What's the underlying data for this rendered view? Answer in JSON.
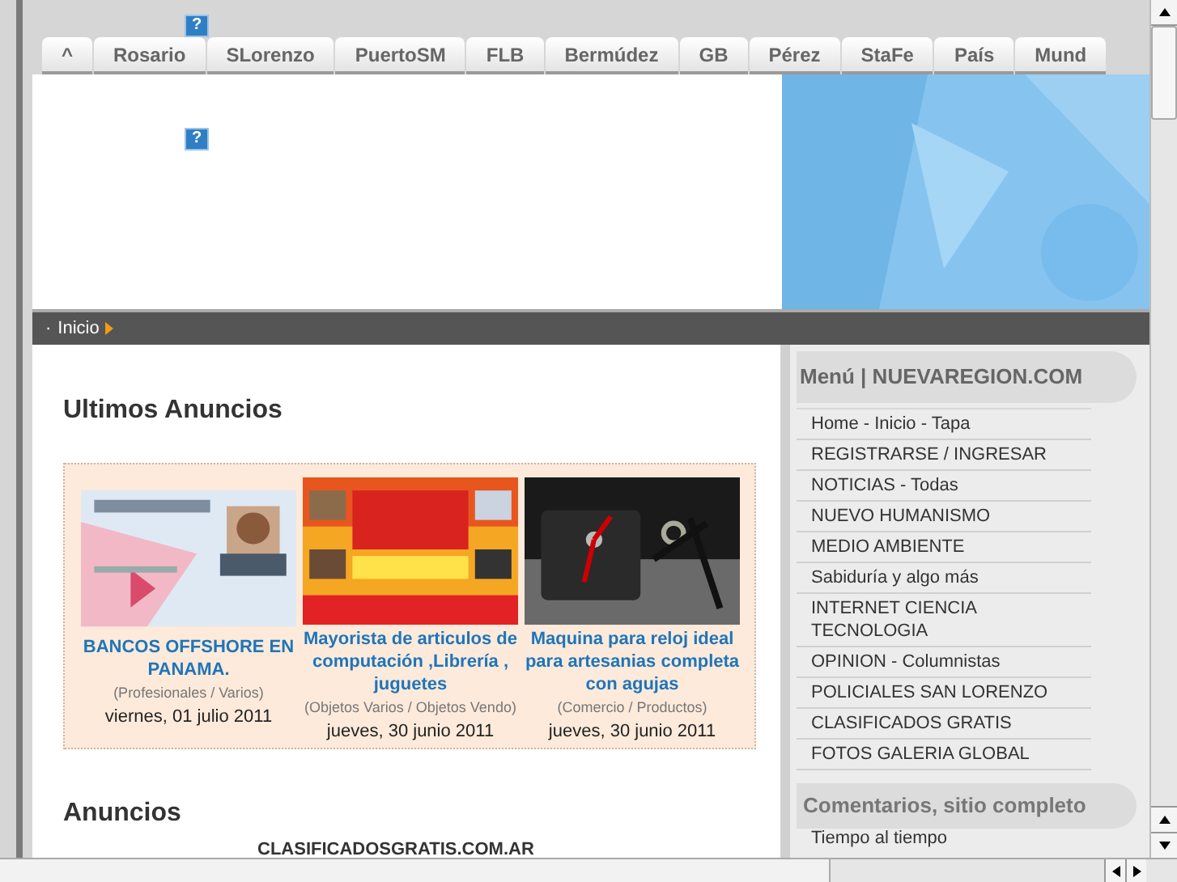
{
  "tabs": [
    {
      "label": "^"
    },
    {
      "label": "Rosario"
    },
    {
      "label": "SLorenzo"
    },
    {
      "label": "PuertoSM"
    },
    {
      "label": "FLB"
    },
    {
      "label": "Bermúdez"
    },
    {
      "label": "GB"
    },
    {
      "label": "Pérez"
    },
    {
      "label": "StaFe"
    },
    {
      "label": "País"
    },
    {
      "label": "Mund"
    }
  ],
  "help_icons": [
    "?",
    "?"
  ],
  "breadcrumb": {
    "bullet": "·",
    "label": "Inicio"
  },
  "latest_ads": {
    "title": "Ultimos Anuncios",
    "ads": [
      {
        "kind": "picture",
        "title": "BANCOS OFFSHORE EN PANAMA.",
        "category": "(Profesionales / Varios)",
        "date": "viernes, 01 julio 2011"
      },
      {
        "kind": "picture",
        "title": "Mayorista de articulos de computación ,Librería , juguetes",
        "category": "(Objetos Varios / Objetos Vendo)",
        "date": "jueves, 30 junio 2011"
      },
      {
        "kind": "picture",
        "title": "Maquina para reloj ideal para artesanias completa con agujas",
        "category": "(Comercio / Productos)",
        "date": "jueves, 30 junio 2011"
      }
    ]
  },
  "ads_section": {
    "title": "Anuncios",
    "subtitle": "CLASIFICADOSGRATIS.COM.AR"
  },
  "sidebar": {
    "menu_title": "Menú | NUEVAREGION.COM",
    "items": [
      "Home - Inicio - Tapa",
      "REGISTRARSE / INGRESAR",
      "NOTICIAS - Todas",
      "NUEVO HUMANISMO",
      "MEDIO AMBIENTE",
      "Sabiduría y algo más",
      "INTERNET CIENCIA TECNOLOGIA",
      "OPINION - Columnistas",
      "POLICIALES SAN LORENZO",
      "CLASIFICADOS GRATIS",
      "FOTOS GALERIA GLOBAL"
    ],
    "comments_title": "Comentarios, sitio completo",
    "comments_first": "Tiempo al tiempo"
  }
}
